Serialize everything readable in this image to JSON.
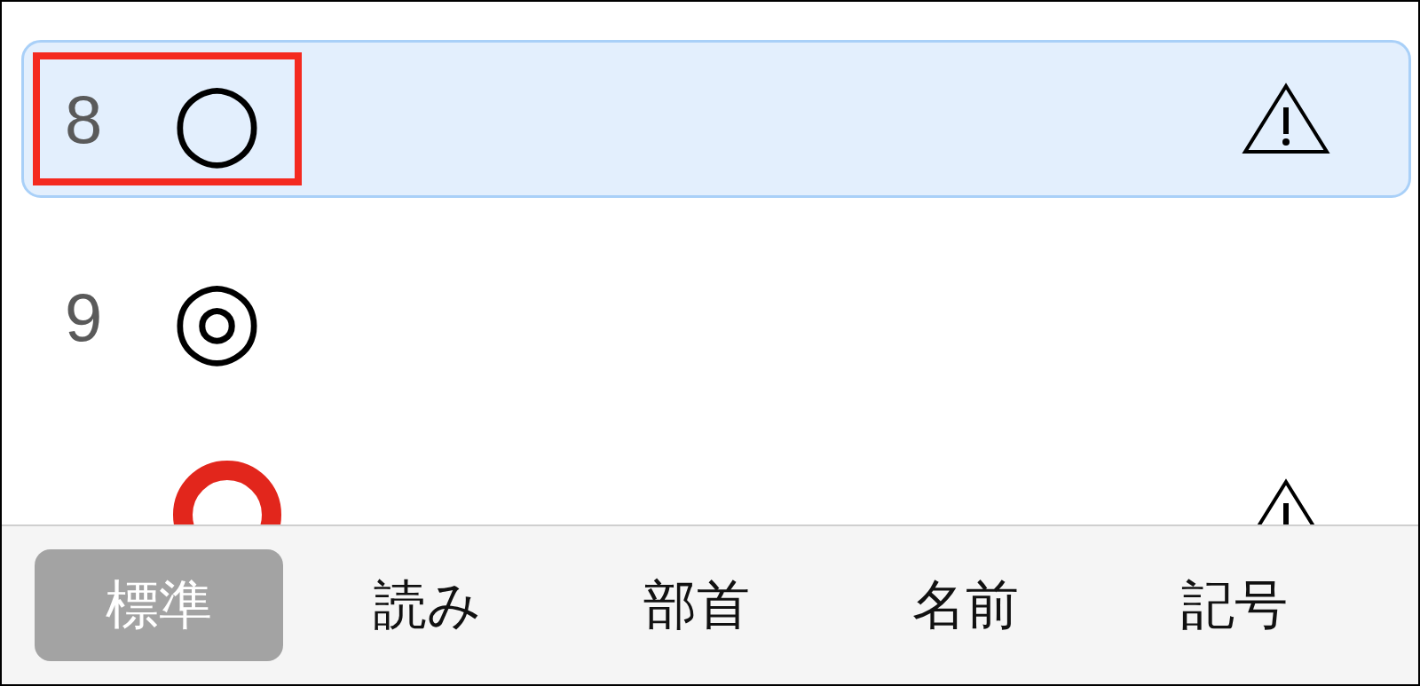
{
  "candidates": [
    {
      "kind": "text",
      "number": "8",
      "text": "○",
      "selected": true,
      "warning": true,
      "annotated": true
    },
    {
      "kind": "text",
      "number": "9",
      "text": "◎",
      "selected": false,
      "warning": false,
      "annotated": false
    },
    {
      "kind": "red-ring",
      "selected": false,
      "warning": true,
      "annotated": false
    }
  ],
  "tabs": [
    {
      "label": "標準",
      "selected": true
    },
    {
      "label": "読み",
      "selected": false
    },
    {
      "label": "部首",
      "selected": false
    },
    {
      "label": "名前",
      "selected": false
    },
    {
      "label": "記号",
      "selected": false
    }
  ]
}
